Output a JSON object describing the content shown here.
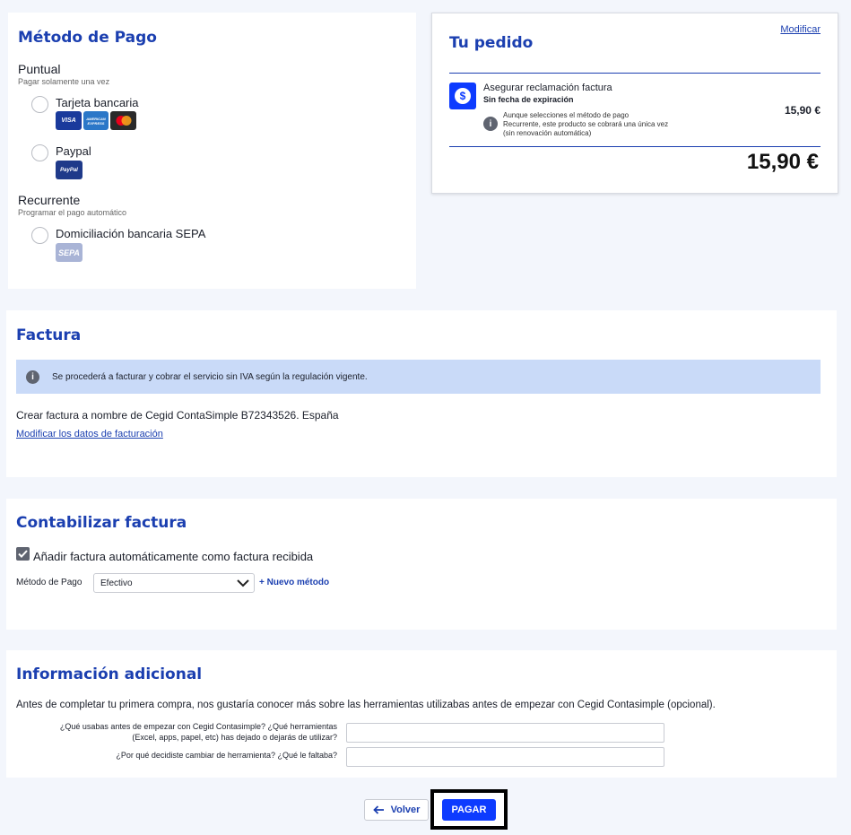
{
  "payment": {
    "title": "Método de Pago",
    "puntual_label": "Puntual",
    "puntual_sub": "Pagar solamente una vez",
    "card_label": "Tarjeta bancaria",
    "visa": "VISA",
    "amex": "AMERICAN EXPRESS",
    "paypal_label": "Paypal",
    "paypal_logo": "PayPal",
    "recurrente_label": "Recurrente",
    "recurrente_sub": "Programar el pago automático",
    "sepa_label": "Domiciliación bancaria SEPA",
    "sepa_logo": "SEPA"
  },
  "order": {
    "title": "Tu pedido",
    "modify": "Modificar",
    "item_name": "Asegurar reclamación factura",
    "item_expiry": "Sin fecha de expiración",
    "item_price": "15,90 €",
    "item_icon_letter": "$",
    "note_line1": "Aunque selecciones el método de pago",
    "note_line2": "Recurrente, este producto se cobrará una única vez",
    "note_line3": "(sin renovación automática)",
    "total": "15,90 €"
  },
  "invoice": {
    "title": "Factura",
    "info": "Se procederá a facturar y cobrar el servicio sin IVA según la regulación vigente.",
    "to": "Crear factura a nombre de Cegid ContaSimple B72343526. España",
    "modify_link": "Modificar los datos de facturación"
  },
  "accounting": {
    "title": "Contabilizar factura",
    "checkbox_label": "Añadir factura automáticamente como factura recibida",
    "checked": true,
    "method_label": "Método de Pago",
    "method_value": "Efectivo",
    "new_method": "+ Nuevo método"
  },
  "additional": {
    "title": "Información adicional",
    "intro": "Antes de completar tu primera compra, nos gustaría conocer más sobre las herramientas utilizabas antes de empezar con Cegid Contasimple (opcional).",
    "q1_line1": "¿Qué usabas antes de empezar con Cegid Contasimple? ¿Qué herramientas",
    "q1_line2": "(Excel, apps, papel, etc) has dejado o dejarás de utilizar?",
    "q2": "¿Por qué decidiste cambiar de herramienta? ¿Qué le faltaba?",
    "q1_value": "",
    "q2_value": ""
  },
  "actions": {
    "back": "Volver",
    "pay": "PAGAR"
  },
  "colors": {
    "accent": "#1b3fb0",
    "primary_button": "#0d3bff",
    "info_bg": "#c9daf8"
  }
}
